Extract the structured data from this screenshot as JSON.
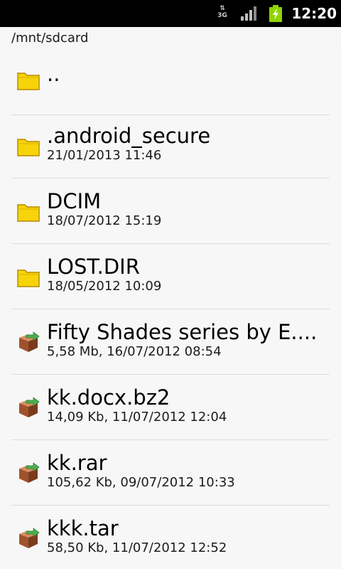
{
  "status_bar": {
    "network_type": "3G",
    "network_arrows": "⇅",
    "clock": "12:20",
    "icons": [
      "network-3g-icon",
      "signal-strength-icon",
      "battery-charging-icon"
    ],
    "colors": {
      "background": "#000000",
      "battery": "#8fd400",
      "signal": "#bfbfbf"
    }
  },
  "path_bar": {
    "path": "/mnt/sdcard"
  },
  "files": [
    {
      "name": "..",
      "meta": "",
      "icon": "folder-icon"
    },
    {
      "name": ".android_secure",
      "meta": "21/01/2013 11:46",
      "icon": "folder-icon"
    },
    {
      "name": "DCIM",
      "meta": "18/07/2012 15:19",
      "icon": "folder-icon"
    },
    {
      "name": "LOST.DIR",
      "meta": "18/05/2012 10:09",
      "icon": "folder-icon"
    },
    {
      "name": "Fifty Shades series by E....",
      "meta": "5,58 Mb, 16/07/2012 08:54",
      "icon": "archive-box-icon"
    },
    {
      "name": "kk.docx.bz2",
      "meta": "14,09 Kb, 11/07/2012 12:04",
      "icon": "archive-box-icon"
    },
    {
      "name": "kk.rar",
      "meta": "105,62 Kb, 09/07/2012 10:33",
      "icon": "archive-box-icon"
    },
    {
      "name": "kkk.tar",
      "meta": "58,50 Kb, 11/07/2012 12:52",
      "icon": "archive-box-icon"
    }
  ],
  "colors": {
    "folder": "#f7d40a",
    "folder_outline": "#b98a00",
    "archive_box": "#a0522d",
    "archive_arrow": "#4caf50"
  }
}
